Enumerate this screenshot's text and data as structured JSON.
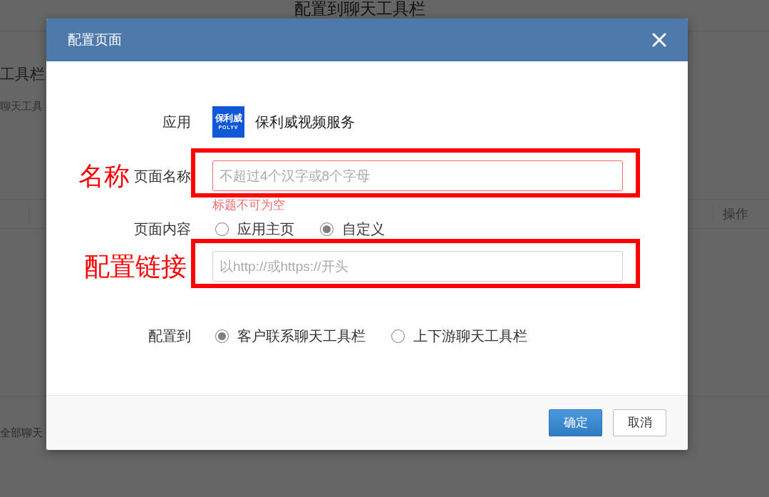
{
  "background_page": {
    "title": "配置到聊天工具栏",
    "heading": "工具栏",
    "description": "聊天工具",
    "table": {
      "columns": [
        {
          "label": "操作"
        }
      ]
    },
    "footer_text": "全部聊天"
  },
  "dialog": {
    "title": "配置页面",
    "fields": [
      {
        "kind": "app",
        "label": "应用",
        "logo_text": "保利威",
        "logo_subtitle": "POLYV",
        "app_name": "保利威视频服务"
      },
      {
        "kind": "text",
        "label": "页面名称",
        "placeholder": "不超过4个汉字或8个字母",
        "invalid": true,
        "error": "标题不可为空",
        "annotation": "名称"
      },
      {
        "kind": "radio",
        "label": "页面内容",
        "options": [
          {
            "label": "应用主页",
            "selected": false
          },
          {
            "label": "自定义",
            "selected": true
          }
        ]
      },
      {
        "kind": "text",
        "placeholder": "以http://或https://开头",
        "invalid": false,
        "annotation": "配置链接"
      },
      {
        "kind": "radio",
        "label": "配置到",
        "options": [
          {
            "label": "客户联系聊天工具栏",
            "selected": true
          },
          {
            "label": "上下游聊天工具栏",
            "selected": false
          }
        ]
      }
    ],
    "buttons": [
      {
        "label": "确定",
        "kind": "primary"
      },
      {
        "label": "取消",
        "kind": "default"
      }
    ]
  }
}
